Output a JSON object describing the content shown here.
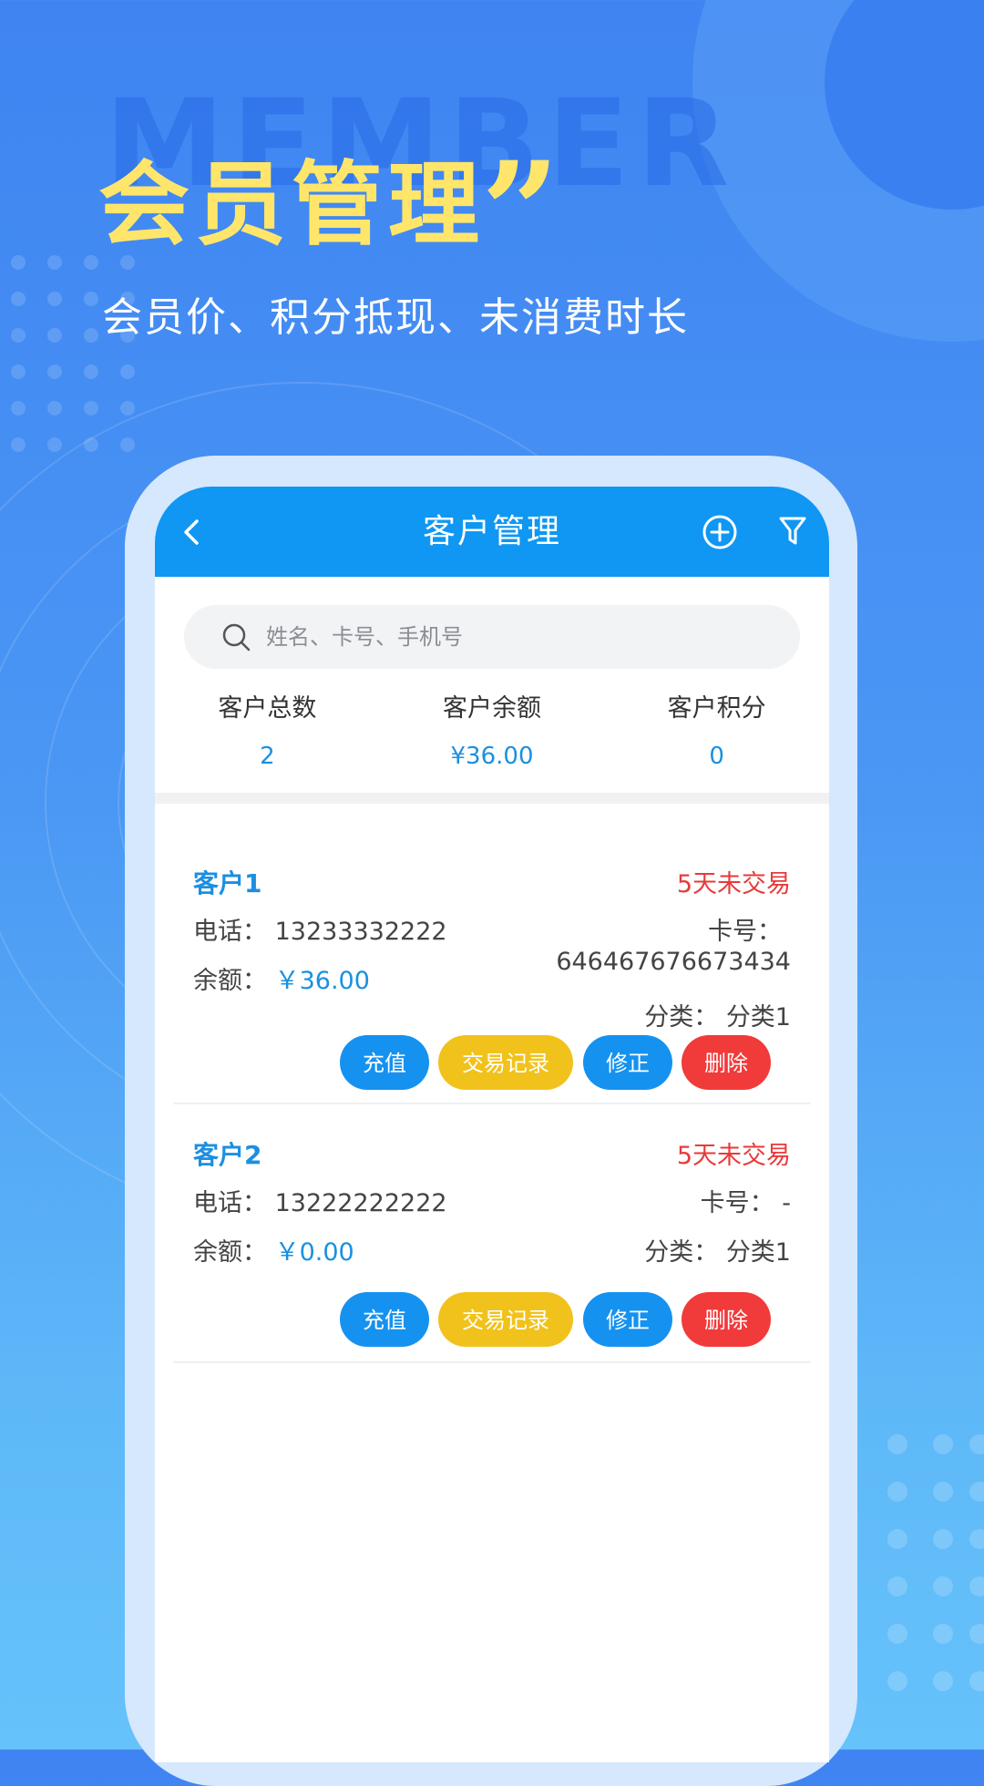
{
  "hero": {
    "watermark": "MEMBER",
    "title": "会员管理",
    "quote": "”",
    "subtitle": "会员价、积分抵现、未消费时长"
  },
  "nav": {
    "title": "客户管理",
    "icons": [
      "back-icon",
      "add-circle-icon",
      "filter-icon"
    ]
  },
  "search": {
    "placeholder": "姓名、卡号、手机号"
  },
  "stats": [
    {
      "label": "客户总数",
      "value": "2"
    },
    {
      "label": "客户余额",
      "value": "¥36.00"
    },
    {
      "label": "客户积分",
      "value": "0"
    }
  ],
  "customers": [
    {
      "name": "客户1",
      "status": "5天未交易",
      "phone_label": "电话：",
      "phone": "13233332222",
      "balance_label": "余额：",
      "balance": "￥36.00",
      "card_label": "卡号：",
      "card": "646467676673434",
      "category_label": "分类：",
      "category": "分类1"
    },
    {
      "name": "客户2",
      "status": "5天未交易",
      "phone_label": "电话：",
      "phone": "13222222222",
      "balance_label": "余额：",
      "balance": "￥0.00",
      "card_label": "卡号：",
      "card": "-",
      "category_label": "分类：",
      "category": "分类1"
    }
  ],
  "actions": {
    "recharge": "充值",
    "records": "交易记录",
    "edit": "修正",
    "delete": "删除"
  },
  "colors": {
    "primary": "#0f97f3",
    "accent_yellow": "#ffe66b",
    "warning": "#e83a3a",
    "button_yellow": "#f1c21b"
  }
}
